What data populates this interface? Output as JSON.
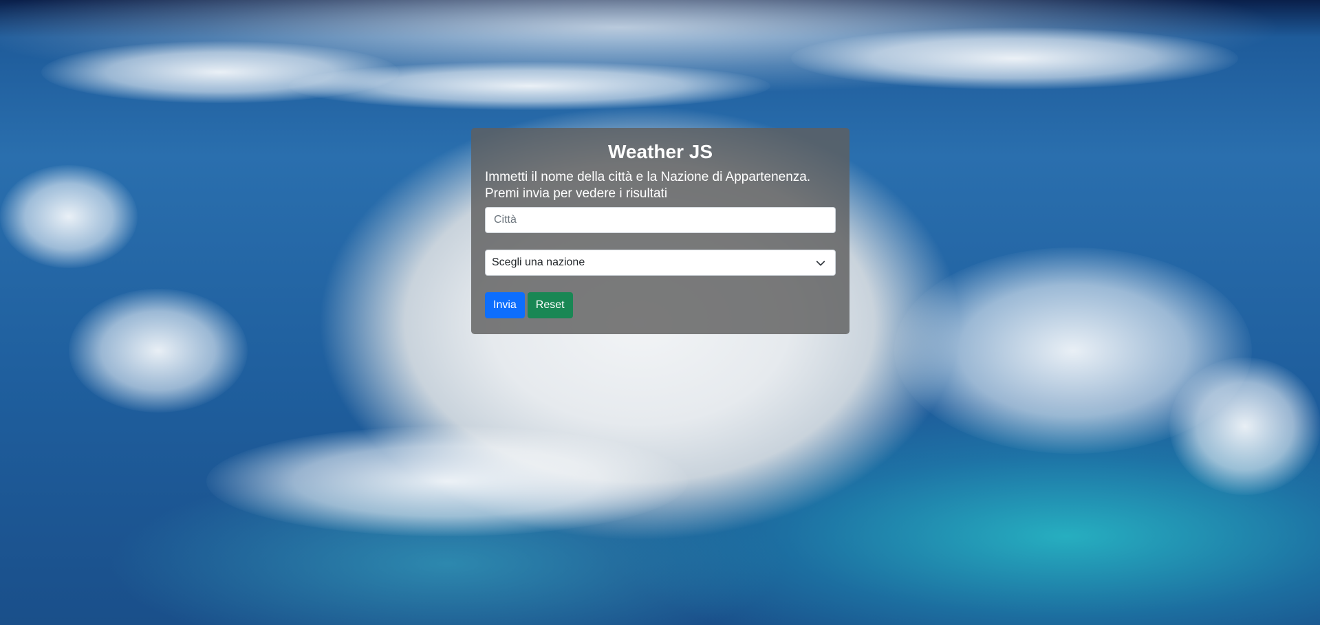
{
  "app": {
    "title": "Weather JS",
    "subtitle": "Immetti il nome della città e la Nazione di Appartenenza. Premi invia per vedere i risultati"
  },
  "form": {
    "city_placeholder": "Città",
    "city_value": "",
    "country_selected": "Scegli una nazione",
    "country_icon": "chevron-down-icon",
    "submit_label": "Invia",
    "reset_label": "Reset"
  },
  "colors": {
    "primary_button": "#0d6efd",
    "reset_button": "#198754",
    "card_background": "rgba(95,95,95,0.82)"
  }
}
